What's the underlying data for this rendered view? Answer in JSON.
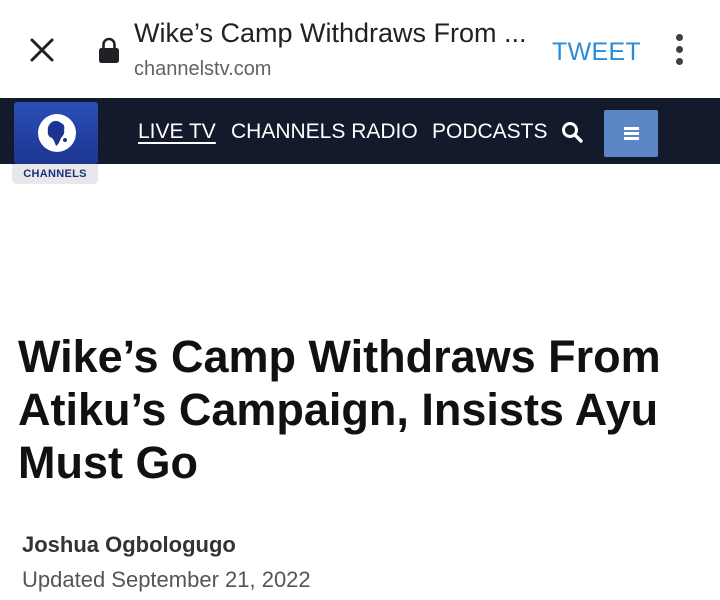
{
  "browser": {
    "title": "Wike’s Camp Withdraws From ...",
    "domain": "channelstv.com",
    "tweet_label": "TWEET",
    "icons": [
      "close-icon",
      "lock-icon",
      "more-vert-icon"
    ]
  },
  "site": {
    "logo_text": "CHANNELS",
    "nav": {
      "live_tv": "LIVE TV",
      "radio": "CHANNELS RADIO",
      "podcasts": "PODCASTS"
    },
    "colors": {
      "nav_bg": "#121a2c",
      "menu_button": "#5b87c5",
      "logo_blue": "#1c3591"
    }
  },
  "article": {
    "headline": "Wike’s Camp Withdraws From Atiku’s Campaign, Insists Ayu Must Go",
    "author": "Joshua Ogbologugo",
    "updated": "Updated September 21, 2022"
  }
}
